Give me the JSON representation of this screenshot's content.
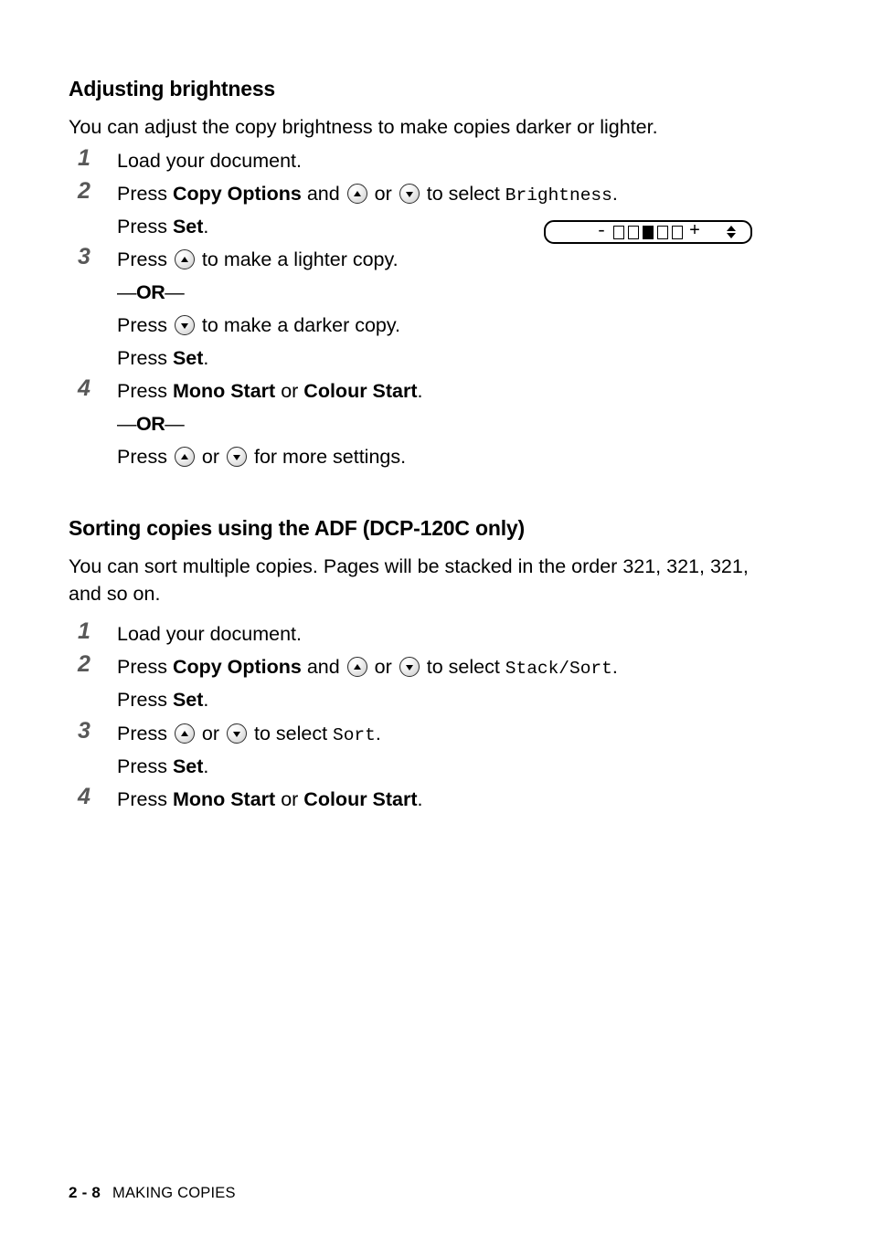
{
  "document": {
    "page_label": "2 - 8",
    "running_title": "MAKING COPIES",
    "step_number_color": "#585858"
  },
  "sections": [
    {
      "heading": "Adjusting brightness",
      "intro": "You can adjust the copy brightness to make copies darker or lighter.",
      "steps": [
        {
          "number": "1",
          "lines": [
            {
              "parts": [
                {
                  "t": "Load your document.",
                  "s": "normal"
                }
              ]
            }
          ]
        },
        {
          "number": "2",
          "lines": [
            {
              "parts": [
                {
                  "t": "Press ",
                  "s": "normal"
                },
                {
                  "t": "Copy Options",
                  "s": "bold"
                },
                {
                  "t": " and ",
                  "s": "normal"
                },
                {
                  "t": "",
                  "s": "key-up"
                },
                {
                  "t": " or ",
                  "s": "normal"
                },
                {
                  "t": "",
                  "s": "key-down"
                },
                {
                  "t": " to select ",
                  "s": "normal"
                },
                {
                  "t": "Brightness",
                  "s": "mono"
                },
                {
                  "t": ".",
                  "s": "normal"
                }
              ]
            },
            {
              "parts": [
                {
                  "t": "Press ",
                  "s": "normal"
                },
                {
                  "t": "Set",
                  "s": "bold"
                },
                {
                  "t": ".",
                  "s": "normal"
                }
              ]
            }
          ]
        },
        {
          "number": "3",
          "lines": [
            {
              "parts": [
                {
                  "t": "Press ",
                  "s": "normal"
                },
                {
                  "t": "",
                  "s": "key-up"
                },
                {
                  "t": " to make a lighter copy.",
                  "s": "normal"
                }
              ]
            },
            {
              "parts": [
                {
                  "t": "—OR—",
                  "s": "or"
                }
              ]
            },
            {
              "parts": [
                {
                  "t": "Press ",
                  "s": "normal"
                },
                {
                  "t": "",
                  "s": "key-down"
                },
                {
                  "t": " to make a darker copy.",
                  "s": "normal"
                }
              ]
            },
            {
              "parts": [
                {
                  "t": "Press ",
                  "s": "normal"
                },
                {
                  "t": "Set",
                  "s": "bold"
                },
                {
                  "t": ".",
                  "s": "normal"
                }
              ]
            }
          ]
        },
        {
          "number": "4",
          "lines": [
            {
              "parts": [
                {
                  "t": "Press ",
                  "s": "normal"
                },
                {
                  "t": "Mono Start",
                  "s": "bold"
                },
                {
                  "t": " or ",
                  "s": "normal"
                },
                {
                  "t": "Colour Start",
                  "s": "bold"
                },
                {
                  "t": ".",
                  "s": "normal"
                }
              ]
            },
            {
              "parts": [
                {
                  "t": "—OR—",
                  "s": "or"
                }
              ]
            },
            {
              "parts": [
                {
                  "t": "Press ",
                  "s": "normal"
                },
                {
                  "t": "",
                  "s": "key-up"
                },
                {
                  "t": " or ",
                  "s": "normal"
                },
                {
                  "t": "",
                  "s": "key-down"
                },
                {
                  "t": " for more settings.",
                  "s": "normal"
                }
              ]
            }
          ]
        }
      ]
    },
    {
      "heading": "Sorting copies using the ADF (DCP-120C only)",
      "intro": "You can sort multiple copies. Pages will be stacked in the order 321, 321, 321, and so on.",
      "steps": [
        {
          "number": "1",
          "lines": [
            {
              "parts": [
                {
                  "t": "Load your document.",
                  "s": "normal"
                }
              ]
            }
          ]
        },
        {
          "number": "2",
          "lines": [
            {
              "parts": [
                {
                  "t": "Press ",
                  "s": "normal"
                },
                {
                  "t": "Copy Options",
                  "s": "bold"
                },
                {
                  "t": " and ",
                  "s": "normal"
                },
                {
                  "t": "",
                  "s": "key-up"
                },
                {
                  "t": " or ",
                  "s": "normal"
                },
                {
                  "t": "",
                  "s": "key-down"
                },
                {
                  "t": " to select ",
                  "s": "normal"
                },
                {
                  "t": "Stack/Sort",
                  "s": "mono"
                },
                {
                  "t": ".",
                  "s": "normal"
                }
              ]
            },
            {
              "parts": [
                {
                  "t": "Press ",
                  "s": "normal"
                },
                {
                  "t": "Set",
                  "s": "bold"
                },
                {
                  "t": ".",
                  "s": "normal"
                }
              ]
            }
          ]
        },
        {
          "number": "3",
          "lines": [
            {
              "parts": [
                {
                  "t": "Press ",
                  "s": "normal"
                },
                {
                  "t": "",
                  "s": "key-up"
                },
                {
                  "t": " or ",
                  "s": "normal"
                },
                {
                  "t": "",
                  "s": "key-down"
                },
                {
                  "t": " to select ",
                  "s": "normal"
                },
                {
                  "t": "Sort",
                  "s": "mono"
                },
                {
                  "t": ".",
                  "s": "normal"
                }
              ]
            },
            {
              "parts": [
                {
                  "t": "Press ",
                  "s": "normal"
                },
                {
                  "t": "Set",
                  "s": "bold"
                },
                {
                  "t": ".",
                  "s": "normal"
                }
              ]
            }
          ]
        },
        {
          "number": "4",
          "lines": [
            {
              "parts": [
                {
                  "t": "Press ",
                  "s": "normal"
                },
                {
                  "t": "Mono Start",
                  "s": "bold"
                },
                {
                  "t": " or ",
                  "s": "normal"
                },
                {
                  "t": "Colour Start",
                  "s": "bold"
                },
                {
                  "t": ".",
                  "s": "normal"
                }
              ]
            }
          ]
        }
      ]
    }
  ],
  "lcd_display": {
    "minus_label": "-",
    "plus_label": "+",
    "segments": [
      "empty",
      "empty",
      "filled",
      "empty",
      "empty"
    ],
    "scroll_indicator": "up-down-arrows"
  }
}
